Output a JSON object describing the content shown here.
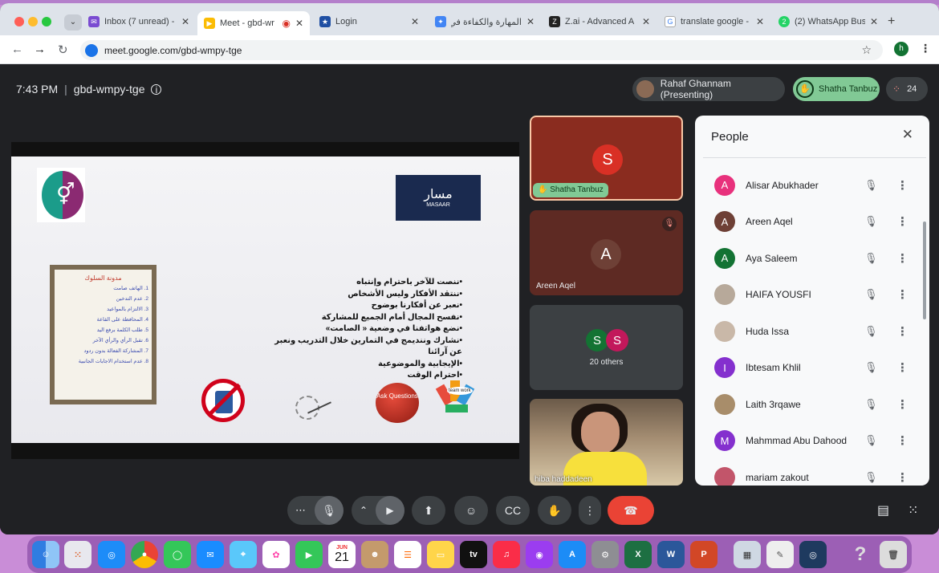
{
  "tabs": [
    {
      "label": "Inbox (7 unread) -",
      "icon": "mail-icon"
    },
    {
      "label": "Meet - gbd-wr",
      "icon": "meet-icon",
      "active": true
    },
    {
      "label": "Login",
      "icon": "eu-flag-icon"
    },
    {
      "label": "المهارة والكفاءة في حر",
      "icon": "gemini-icon"
    },
    {
      "label": "Z.ai - Advanced A",
      "icon": "zai-icon"
    },
    {
      "label": "translate google -",
      "icon": "google-icon"
    },
    {
      "label": "(2) WhatsApp Bus",
      "icon": "whatsapp-icon"
    }
  ],
  "address": {
    "url": "meet.google.com/gbd-wmpy-tge"
  },
  "profile_initial": "h",
  "meeting": {
    "time": "7:43 PM",
    "separator": "|",
    "code": "gbd-wmpy-tge",
    "presenter_label": "Rahaf Ghannam (Presenting)",
    "hand_raised_name": "Shatha Tanbuz",
    "participant_count": "24"
  },
  "slide": {
    "logo_text": "مسار",
    "logo_subtext": "MASAAR",
    "chart_title": "مدونة السلوك",
    "chart_lines": [
      "1. الهاتف صامت",
      "2. عدم التدخين",
      "3. الالتزام بالمواعيد",
      "4. المحافظة على القاعة",
      "5. طلب الكلمة برفع اليد",
      "6. تقبل الرأي والرأي الآخر",
      "7. المشاركة الفعالة بدون ردود",
      "8. عدم استخدام الاجابات الجانبية"
    ],
    "lines": [
      "•ننصت للآخر باحترام وإنتباه",
      "•ننتقد الأفكار وليس الأشخاص",
      "•نعبر عن أفكارنا بوضوح",
      "•نفسح المجال أمام الجميع للمشاركة",
      "•نضع هواتفنا في وضعية « الصامت»",
      "•نشارك وننديمج في التمارين خلال التدريب ونعبر عن آرائنا",
      "•الإيجابية والموضوعية",
      "•احترام الوقت"
    ],
    "ask_label": "Ask Questions",
    "team_label": "team work"
  },
  "tiles": {
    "shatha": {
      "initial": "S",
      "name": "Shatha Tanbuz",
      "bg": "#8a2c1f",
      "avatar": "#d93025"
    },
    "areen": {
      "initial": "A",
      "name": "Areen Aqel",
      "bg": "#5e2a23",
      "avatar": "#6e4036"
    },
    "others": {
      "initial1": "S",
      "initial2": "S",
      "label": "20 others"
    },
    "hiba": {
      "name": "hiba haddadeen"
    }
  },
  "people": {
    "title": "People",
    "rows": [
      {
        "initial": "A",
        "name": "Alisar Abukhader",
        "color": "#e8317c"
      },
      {
        "initial": "A",
        "name": "Areen Aqel",
        "color": "#6e4036"
      },
      {
        "initial": "A",
        "name": "Aya Saleem",
        "color": "#137333"
      },
      {
        "initial": "",
        "name": "HAIFA YOUSFI",
        "color": "#b7a99a"
      },
      {
        "initial": "",
        "name": "Huda Issa",
        "color": "#c9b8a8"
      },
      {
        "initial": "I",
        "name": "Ibtesam Khlil",
        "color": "#8430ce"
      },
      {
        "initial": "",
        "name": "Laith 3rqawe",
        "color": "#a88d6a"
      },
      {
        "initial": "M",
        "name": "Mahmmad Abu Dahood",
        "color": "#8430ce"
      },
      {
        "initial": "",
        "name": "mariam zakout",
        "color": "#c2556a"
      }
    ]
  },
  "dock": {
    "calendar_month": "JUN",
    "calendar_day": "21",
    "tv_label": "tv"
  },
  "colors": {
    "accent": "#1a73e8",
    "hand_green": "#81c995",
    "end_call": "#ea4335",
    "panel_bg": "#f8f9fa"
  }
}
